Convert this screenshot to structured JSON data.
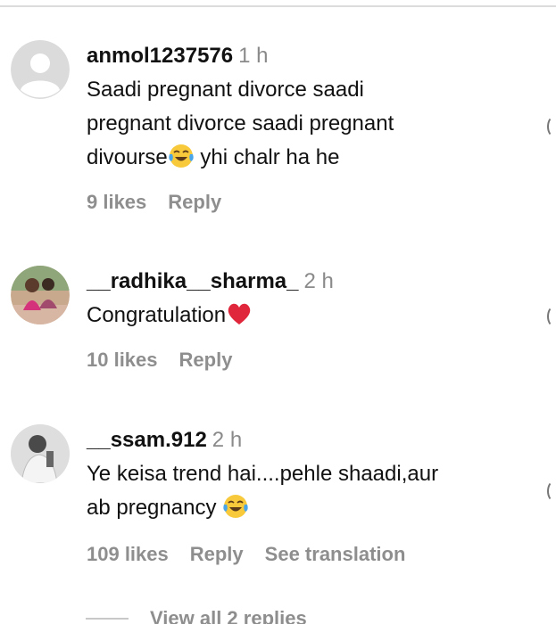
{
  "comments": [
    {
      "username": "anmol1237576",
      "time": "1 h",
      "text_lines": [
        "Saadi pregnant divorce saadi",
        "pregnant divorce saadi pregnant",
        "divourse"
      ],
      "text_after_emoji": " yhi chalr ha he",
      "emoji": "tears-of-joy-emoji",
      "likes": "9 likes",
      "reply": "Reply",
      "avatar": "default-avatar-icon"
    },
    {
      "username": "__radhika__sharma_",
      "time": "2 h",
      "text_lines": [
        "Congratulation"
      ],
      "emoji": "red-heart-emoji",
      "likes": "10 likes",
      "reply": "Reply",
      "avatar": "photo-avatar"
    },
    {
      "username": "__ssam.912",
      "time": "2 h",
      "text_lines": [
        "Ye keisa trend hai....pehle shaadi,aur",
        "ab pregnancy "
      ],
      "emoji": "tears-of-joy-emoji",
      "likes": "109 likes",
      "reply": "Reply",
      "translate": "See translation",
      "avatar": "photo-avatar"
    }
  ],
  "view_replies": "View all 2 replies",
  "colors": {
    "muted": "#8e8e8e",
    "text": "#111111",
    "heart": "#e0263a"
  }
}
